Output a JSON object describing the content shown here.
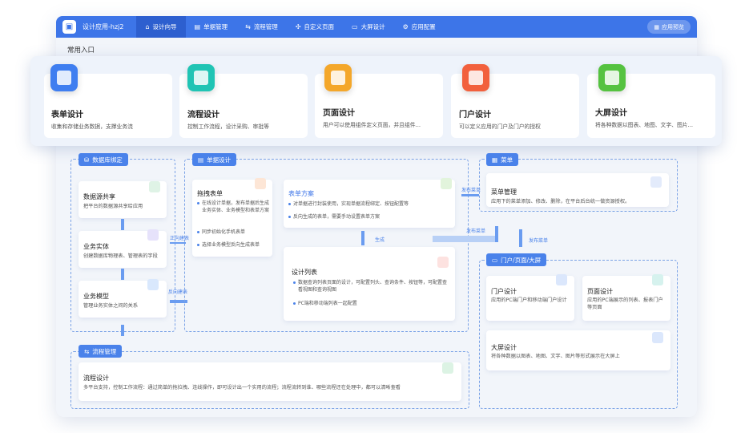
{
  "app": {
    "name": "设计应用-hzj2",
    "preview_label": "应用预览"
  },
  "nav": [
    {
      "label": "设计向导",
      "icon": "home-icon"
    },
    {
      "label": "单据管理",
      "icon": "document-icon"
    },
    {
      "label": "流程管理",
      "icon": "flow-icon"
    },
    {
      "label": "自定义页面",
      "icon": "puzzle-icon"
    },
    {
      "label": "大屏设计",
      "icon": "monitor-icon"
    },
    {
      "label": "应用配置",
      "icon": "gear-icon"
    }
  ],
  "common_entry": "常用入口",
  "cards": [
    {
      "title": "表单设计",
      "desc": "收集和存储业务数据，支撑业务流",
      "color": "#3f7ef0",
      "icon": "form-icon"
    },
    {
      "title": "流程设计",
      "desc": "控制工作流程，设计采购、审批等",
      "color": "#20c4b4",
      "icon": "flow-design-icon"
    },
    {
      "title": "页面设计",
      "desc": "用户可以使用组件定义页面，并且组件...",
      "color": "#f4a72a",
      "icon": "page-design-icon"
    },
    {
      "title": "门户设计",
      "desc": "可以定义应用的门户及门户的授权",
      "color": "#f2603d",
      "icon": "portal-design-icon"
    },
    {
      "title": "大屏设计",
      "desc": "将各种数据以图表、地图、文字、图片...",
      "color": "#55c240",
      "icon": "bigscreen-design-icon"
    }
  ],
  "db": {
    "tag": "数据库绑定",
    "share": {
      "title": "数据源共享",
      "desc": "把平台的数据源共享给应用"
    },
    "entity": {
      "title": "业务实体",
      "desc": "创建数据库物理表、管理表的字段"
    },
    "model": {
      "title": "业务模型",
      "desc": "管理业务实体之间的关系"
    }
  },
  "doc": {
    "tag": "单据设计",
    "drag": {
      "title": "拖拽表单",
      "b1": "在线设计单据，发布单据后生成业务实体、业务模型和表单方案",
      "b2": "同步初始化手机表单",
      "b3": "选择业务模型反向生成表单"
    },
    "scheme": {
      "title": "表单方案",
      "b1": "对单据进行封装使用，实现单据流程绑定、按钮配置等",
      "b2": "反向生成的表单，需要手动设置表单方案"
    },
    "list": {
      "title": "设计列表",
      "b1": "数据查询列表页面的设计，可配置列头、查询条件、按钮等，可配置查看视图和查询视图",
      "b2": "PC端和移动端列表一起配置"
    }
  },
  "menu": {
    "tag": "菜单",
    "title": "菜单管理",
    "desc": "应用下的菜单添加、修改、删除，在平台后台统一做资源授权。"
  },
  "portal": {
    "tag": "门户/页面/大屏",
    "portal": {
      "title": "门户设计",
      "desc": "应用的PC端门户和移动端门户设计"
    },
    "page": {
      "title": "页面设计",
      "desc": "应用的PC端展示的列表、报表门户等页面"
    },
    "screen": {
      "title": "大屏设计",
      "desc": "将各种数据以图表、地图、文字、图片等形式展示在大屏上"
    }
  },
  "flow": {
    "tag": "流程管理",
    "title": "流程设计",
    "desc": "多平台支持，控制工作流程：通过简单的拖拉拽、连线操作，即可设计出一个实用的流程；流程流转到谁、哪些流程还在处理中，都可以清晰查看"
  },
  "labels": {
    "forward": "正向建表",
    "reverse": "反向建表",
    "generate": "生成",
    "publish1": "发布菜单",
    "publish2": "发布菜单",
    "publish3": "发布菜单"
  }
}
